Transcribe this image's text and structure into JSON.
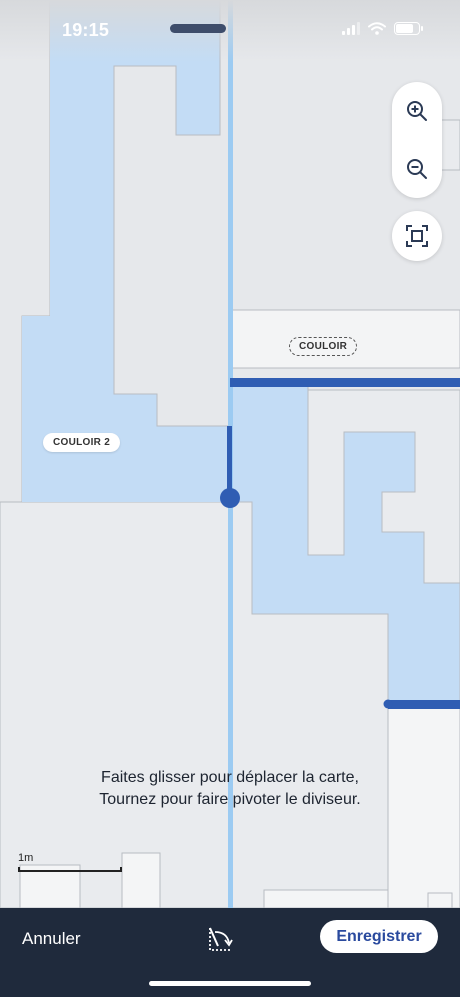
{
  "status_bar": {
    "time": "19:15"
  },
  "map": {
    "rooms": [
      {
        "name": "COULOIR",
        "style": "dashed"
      },
      {
        "name": "COULOIR 2",
        "style": "solid"
      }
    ],
    "highlight_color": "#c3dcf5",
    "divider_color": "#2f5db3",
    "divider_line_color": "#9ccbf2"
  },
  "controls": {
    "zoom_in_icon": "zoom-in-icon",
    "zoom_out_icon": "zoom-out-icon",
    "fit_icon": "fit-screen-icon"
  },
  "hint": {
    "line1": "Faites glisser pour déplacer la carte,",
    "line2": "Tournez pour faire pivoter le diviseur."
  },
  "scale": {
    "label": "1m"
  },
  "bottom_bar": {
    "cancel_label": "Annuler",
    "rotate_icon": "rotate-divider-icon",
    "save_label": "Enregistrer",
    "accent": "#2a4a9e",
    "background": "#1f2a3c"
  }
}
